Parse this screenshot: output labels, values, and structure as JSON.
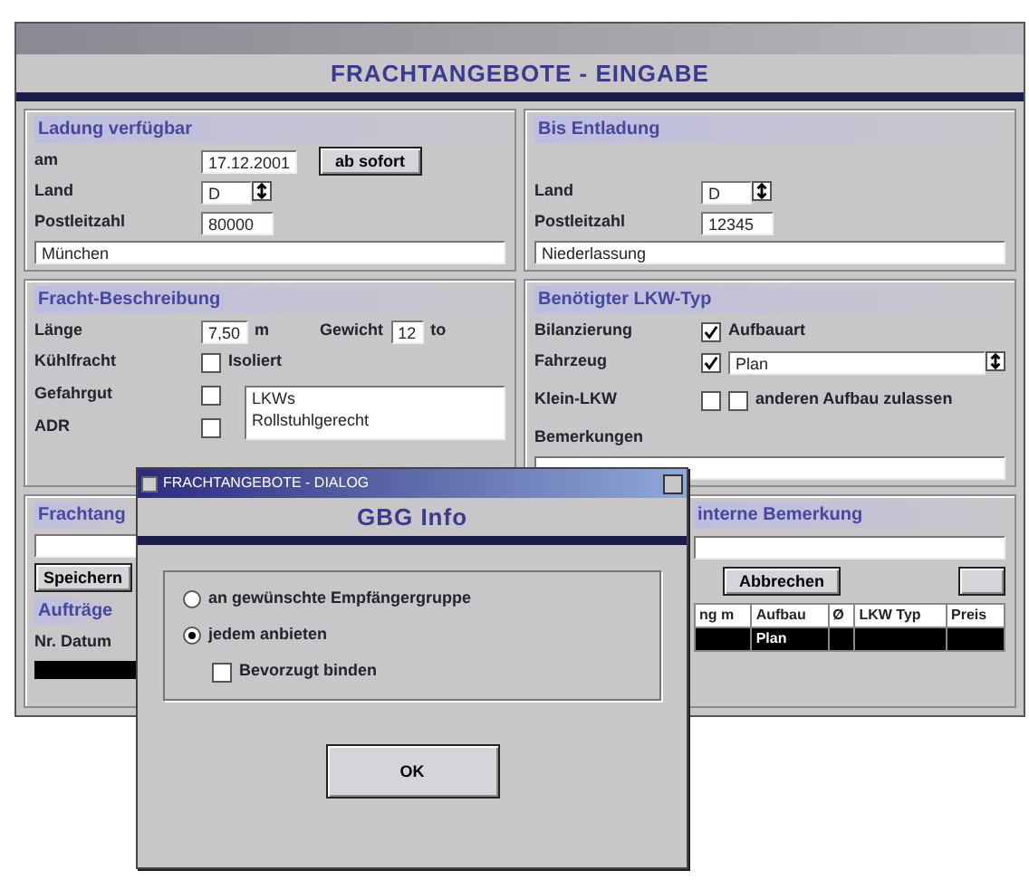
{
  "main_window": {
    "title": "FRACHTANGEBOTE - EINGABE"
  },
  "loading": {
    "heading": "Ladung verfügbar",
    "date_label": "am",
    "date": "17.12.2001",
    "now_button": "ab sofort",
    "country_label": "Land",
    "country": "D",
    "zip_label": "Postleitzahl",
    "zip": "80000",
    "place": "München"
  },
  "unloading": {
    "heading": "Bis Entladung",
    "country_label": "Land",
    "country": "D",
    "zip_label": "Postleitzahl",
    "zip": "12345",
    "place": "Niederlassung"
  },
  "freight": {
    "heading": "Fracht-Beschreibung",
    "length_label": "Länge",
    "length": "7,50",
    "length_unit": "m",
    "weight_label": "Gewicht",
    "weight": "12",
    "weight_unit": "to",
    "options": [
      {
        "label": "Kühlfracht",
        "checked": false,
        "note": "Isoliert"
      },
      {
        "label": "Gefahrgut",
        "checked": false
      },
      {
        "label": "ADR",
        "checked": false
      }
    ],
    "list": [
      "LKWs",
      "Rollstuhlgerecht"
    ]
  },
  "truck": {
    "heading": "Benötigter LKW-Typ",
    "rows": [
      {
        "kind": "check",
        "label": "Bilanzierung",
        "checked": true,
        "text": "Aufbauart"
      },
      {
        "kind": "combo",
        "label": "Fahrzeug",
        "checked": true,
        "value": "Plan"
      },
      {
        "kind": "check2",
        "label": "Klein-LKW",
        "checked": false,
        "checked2": false,
        "text": "anderen Aufbau zulassen"
      },
      {
        "kind": "label",
        "label": "Bemerkungen"
      }
    ]
  },
  "bottom_left": {
    "label": "Frachtang",
    "button": "Speichern",
    "list_label": "Aufträge",
    "column": "Nr. Datum"
  },
  "bottom_right": {
    "label": "interne Bemerkung",
    "cancel_button": "Abbrechen",
    "columns": [
      "ng m",
      "Aufbau",
      "Ø",
      "LKW Typ",
      "Preis"
    ],
    "rows": [
      {
        "selected": true,
        "cells": [
          "",
          "Plan",
          "",
          "",
          ""
        ]
      }
    ]
  },
  "dialog": {
    "title": "FRACHTANGEBOTE - DIALOG",
    "heading": "GBG Info",
    "options": [
      {
        "label": "an gewünschte Empfängergruppe",
        "selected": false
      },
      {
        "label": "jedem anbieten",
        "selected": true
      }
    ],
    "checkbox": {
      "label": "Bevorzugt binden",
      "checked": false
    },
    "ok_button": "OK"
  }
}
